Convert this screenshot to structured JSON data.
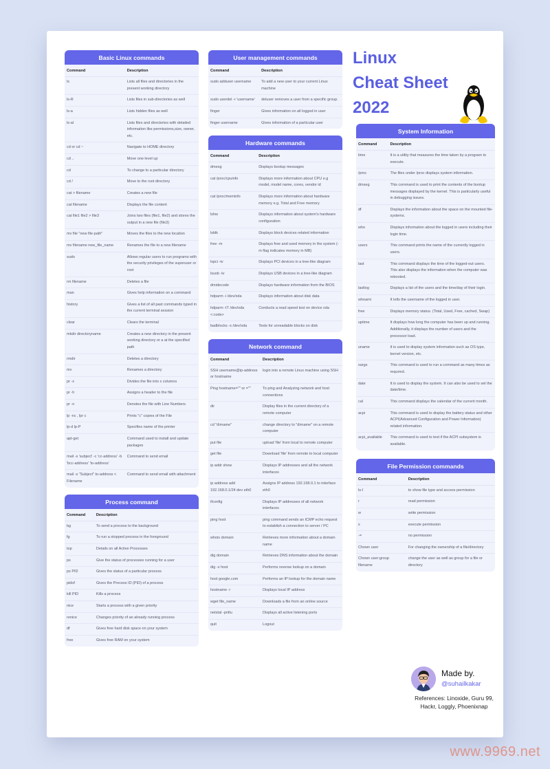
{
  "title": {
    "line1": "Linux",
    "line2": "Cheat Sheet",
    "line3": "2022"
  },
  "colors": {
    "accent": "#6366e8",
    "section_bg": "#f0f2fc",
    "page_bg": "#d9e1f4"
  },
  "headers": {
    "command": "Command",
    "description": "Description"
  },
  "sections": {
    "basic": {
      "title": "Basic Linux commands",
      "rows": [
        [
          "ls",
          "Lists all files and directories in the present working directory"
        ],
        [
          "ls-R",
          "Lists files in sub-directories as well"
        ],
        [
          "ls-a",
          "Lists hidden files as well"
        ],
        [
          "ls-al",
          "Lists files and directories with detailed information like permissions,size, owner, etc."
        ],
        [
          "cd or cd ~",
          "Navigate to HOME directory"
        ],
        [
          "cd ..",
          "Move one level up"
        ],
        [
          "cd",
          "To change to a particular directory"
        ],
        [
          "cd /",
          "Move to the root directory"
        ],
        [
          "cat > filename",
          "Creates a new file"
        ],
        [
          "cat filename",
          "Displays the file content"
        ],
        [
          "cat file1 file2 > file3",
          "Joins two files (file1, file2) and stores the output in a new file (file3)"
        ],
        [
          "mv file \"new file path\"",
          "Moves the files to the new location"
        ],
        [
          "mv filename new_file_name",
          "Renames the file to a new filename"
        ],
        [
          "sudo",
          "Allows regular users to run programs with the security privileges of the superuser or root"
        ],
        [
          "rm filename",
          "Deletes a file"
        ],
        [
          "man",
          "Gives help information on a command"
        ],
        [
          "history",
          "Gives a list of all past commands typed in the current terminal session"
        ],
        [
          "clear",
          "Clears the terminal"
        ],
        [
          "mkdir directoryname",
          "Creates a new directory in the present working directory or a at the specified path"
        ],
        [
          "rmdir",
          "Deletes a directory"
        ],
        [
          "mv",
          "Renames a directory"
        ],
        [
          "pr -x",
          "Divides the file into x columns"
        ],
        [
          "pr -h",
          "Assigns a header to the file"
        ],
        [
          "pr -n",
          "Denotes the file with Line Numbers"
        ],
        [
          "lp -nc , lpr c",
          "Prints \"c\" copies of the File"
        ],
        [
          "lp-d lp-P",
          "Specifies name of the printer"
        ],
        [
          "apt-get",
          "Command used to install and update packages"
        ],
        [
          "mail -s 'subject' -c 'cc-address' -b 'bcc-address' 'to-address'",
          "Command to send email"
        ],
        [
          "mail -s \"Subject\" to-address < Filename",
          "Command to send email with attachment"
        ]
      ]
    },
    "process": {
      "title": "Process command",
      "rows": [
        [
          "bg",
          "To send a process to the background"
        ],
        [
          "fg",
          "To run a stopped process in the foreground"
        ],
        [
          "top",
          "Details on all Active Processes"
        ],
        [
          "ps",
          "Give the status of processes running for a user"
        ],
        [
          "ps PID",
          "Gives the status of a particular process"
        ],
        [
          "pidof",
          "Gives the Process ID (PID) of a process"
        ],
        [
          "kill PID",
          "Kills a process"
        ],
        [
          "nice",
          "Starts a process with a given priority"
        ],
        [
          "renice",
          "Changes priority of an already running process"
        ],
        [
          "df",
          "Gives free hard disk space on your system"
        ],
        [
          "free",
          "Gives free RAM on your system"
        ]
      ]
    },
    "user": {
      "title": "User management commands",
      "rows": [
        [
          "sudo adduser username",
          "To add a new user to your current Linux machine"
        ],
        [
          "sudo userdel -r 'username'",
          "deluser removes a user from a specific group."
        ],
        [
          "finger",
          "Gives information on all logged in user"
        ],
        [
          "finger username",
          "Gives information of a particular user"
        ]
      ]
    },
    "hardware": {
      "title": "Hardware commands",
      "rows": [
        [
          "dmesg",
          "Displays bootup messages"
        ],
        [
          "cat /proc/cpuinfo",
          "Displays more information about CPU e.g model, model name, cores, vendor id"
        ],
        [
          "cat /proc/meminfo",
          "Displays more information about hardware memory e.g. Total and Free memory"
        ],
        [
          "lshw",
          "Displays information about system's hardware configuration"
        ],
        [
          "lsblk",
          "Displays block devices related information"
        ],
        [
          "free -m",
          "Displays free and used memory in the system (-m flag indicates memory in MB)"
        ],
        [
          "lspci -tv",
          "Displays PCI devices in a tree-like diagram"
        ],
        [
          "lsusb -tv",
          "Displays USB devices in a tree-like diagram"
        ],
        [
          "dmidecode",
          "Displays hardware information from the BIOS"
        ],
        [
          "hdparm -i /dev/xda",
          "Displays information about disk data"
        ],
        [
          "hdparm -tT /dev/xda <:code>",
          "Conducts a read speed test on device xda"
        ],
        [
          "badblocks -s /dev/xda",
          "Tests  for unreadable blocks on disk"
        ]
      ]
    },
    "network": {
      "title": "Network command",
      "rows": [
        [
          "SSH username@ip-address or hostname",
          "login into a remote Linux machine using SSH"
        ],
        [
          "Ping hostname=\"\" or =\"\"",
          "To ping and Analyzing network and host connections"
        ],
        [
          "dir",
          "Display files in the current directory of a remote computer"
        ],
        [
          "cd \"dirname\"",
          "change directory to \"dirname\" on a remote computer"
        ],
        [
          "put file",
          "upload 'file' from local to remote computer"
        ],
        [
          "get file",
          "Download 'file' from remote to local computer"
        ],
        [
          "ip addr show",
          "Displays IP addresses and all the network interfaces"
        ],
        [
          "ip address add 192.168.0.1/24 dev eth0",
          "Assigns IP address 192.168.0.1 to interface eth0"
        ],
        [
          "ifconfig",
          "Displays IP addresses of all network interfaces"
        ],
        [
          "ping  host",
          "ping command sends an ICMP echo request to establish a connection to server / PC"
        ],
        [
          "whois domain",
          "Retrieves more information about a domain name"
        ],
        [
          "dig domain",
          "Retrieves DNS information about the domain"
        ],
        [
          "dig -x host",
          "Performs reverse lookup on a domain"
        ],
        [
          "host google.com",
          "Performs an IP lookup for the domain name"
        ],
        [
          "hostname -i",
          "Displays local IP address"
        ],
        [
          "wget file_name",
          "Downloads a file from an online source"
        ],
        [
          "netstat -pnltu",
          "Displays all active listening ports"
        ],
        [
          "quit",
          "Logout"
        ]
      ]
    },
    "system": {
      "title": "System Information",
      "rows": [
        [
          "time",
          "It is a utility that measures the time taken by a program to execute."
        ],
        [
          "/proc",
          "The files under /proc displays system information."
        ],
        [
          "dmseg",
          "This command is used to print the contents of the bootup messages displayed by the kernel. This is particularly useful in debugging issues."
        ],
        [
          "df",
          "Displays the information about the space on the mounted file-systems."
        ],
        [
          "who",
          "Displays information about the logged in users including their login time."
        ],
        [
          "users",
          "This command prints the name of the currently logged in users."
        ],
        [
          "last",
          "This command displays the time of the logged-out users. This also displays the information when the computer was rebooted."
        ],
        [
          "lastlog",
          "Displays a list of the users and the time/day of their login."
        ],
        [
          "whoami",
          "It tells the username of the logged in user."
        ],
        [
          "free",
          "Displays memory status. (Total, Used, Free, cached, Swap)"
        ],
        [
          "uptime",
          "It displays how long the computer has been up and running. Additionally, it displays the number of users and the processor load."
        ],
        [
          "uname",
          "It is used to display system information such as OS type, kernel version, etc."
        ],
        [
          "xargs",
          "This command is used to run a command as many times as required."
        ],
        [
          "date",
          "It is used to display the system. It can also be used to set the date/time."
        ],
        [
          "cal",
          "This command displays the calendar of the current month."
        ],
        [
          "acpi",
          "This command is used to display the battery status and other ACPI(Advanced Configuration and Power Information) related  information."
        ],
        [
          "acpi_available",
          "This command is used to test if the ACPI subsystem is available."
        ]
      ]
    },
    "permission": {
      "title": "File Permission commands",
      "rows": [
        [
          "ls-l",
          "to show file type and access permission"
        ],
        [
          "r",
          "read permission"
        ],
        [
          "w",
          "write permission"
        ],
        [
          "x",
          "execute permission"
        ],
        [
          "-=",
          "no permission"
        ],
        [
          "Chown user",
          "For changing the ownership of a file/directory"
        ],
        [
          "Chown user:group filename",
          "change the user as well as group for a file or directory"
        ]
      ]
    }
  },
  "credit": {
    "made_by": "Made by.",
    "handle": "@suhailkakar",
    "references": "References: Linoxide, Guru 99, Hackr, Loggly, Phoenixnap"
  },
  "watermark": "www.9969.net"
}
